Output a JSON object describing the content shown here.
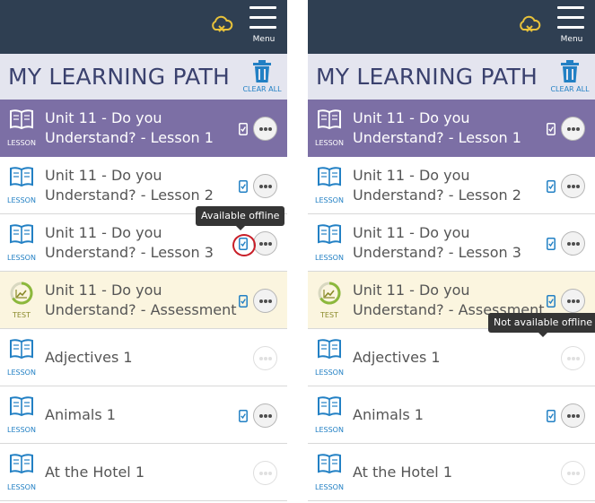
{
  "colors": {
    "topbar": "#2f3f52",
    "titlebar": "#e4e5ef",
    "title_text": "#3a416e",
    "accent_blue": "#2280c4",
    "active_row": "#7c6fa5",
    "test_row": "#fbf5df",
    "cloud_icon": "#e8c23a",
    "highlight_ring": "#c81e28",
    "tooltip_bg": "#353535"
  },
  "panels": [
    {
      "header": {
        "cloud_icon": "cloud-offline-icon",
        "menu_label": "Menu"
      },
      "title": "MY LEARNING PATH",
      "clear_all": "CLEAR ALL",
      "tooltip": "Available offline",
      "items": [
        {
          "title_line1": "Unit 11 - Do you",
          "title_line2": "Understand? - Lesson 1",
          "type": "LESSON",
          "icon": "book-icon",
          "offline_available": true,
          "state": "active"
        },
        {
          "title_line1": "Unit 11 - Do you",
          "title_line2": "Understand? - Lesson 2",
          "type": "LESSON",
          "icon": "book-icon",
          "offline_available": true,
          "state": "normal"
        },
        {
          "title_line1": "Unit 11 - Do you",
          "title_line2": "Understand? - Lesson 3",
          "type": "LESSON",
          "icon": "book-icon",
          "offline_available": true,
          "state": "normal"
        },
        {
          "title_line1": "Unit 11 - Do you",
          "title_line2": "Understand? - Assessment",
          "type": "TEST",
          "icon": "test-chart-icon",
          "offline_available": true,
          "state": "test"
        },
        {
          "title": "Adjectives 1",
          "type": "LESSON",
          "icon": "book-icon",
          "offline_available": false,
          "state": "normal"
        },
        {
          "title": "Animals 1",
          "type": "LESSON",
          "icon": "book-icon",
          "offline_available": true,
          "state": "normal"
        },
        {
          "title": "At the Hotel 1",
          "type": "LESSON",
          "icon": "book-icon",
          "offline_available": false,
          "state": "normal"
        }
      ]
    },
    {
      "header": {
        "cloud_icon": "cloud-offline-icon",
        "menu_label": "Menu"
      },
      "title": "MY LEARNING PATH",
      "clear_all": "CLEAR ALL",
      "tooltip": "Not available offline",
      "items": [
        {
          "title_line1": "Unit 11 - Do you",
          "title_line2": "Understand? - Lesson 1",
          "type": "LESSON",
          "icon": "book-icon",
          "offline_available": true,
          "state": "active"
        },
        {
          "title_line1": "Unit 11 - Do you",
          "title_line2": "Understand? - Lesson 2",
          "type": "LESSON",
          "icon": "book-icon",
          "offline_available": true,
          "state": "normal"
        },
        {
          "title_line1": "Unit 11 - Do you",
          "title_line2": "Understand? - Lesson 3",
          "type": "LESSON",
          "icon": "book-icon",
          "offline_available": true,
          "state": "normal"
        },
        {
          "title_line1": "Unit 11 - Do you",
          "title_line2": "Understand? - Assessment",
          "type": "TEST",
          "icon": "test-chart-icon",
          "offline_available": true,
          "state": "test"
        },
        {
          "title": "Adjectives 1",
          "type": "LESSON",
          "icon": "book-icon",
          "offline_available": false,
          "state": "normal"
        },
        {
          "title": "Animals 1",
          "type": "LESSON",
          "icon": "book-icon",
          "offline_available": true,
          "state": "normal"
        },
        {
          "title": "At the Hotel 1",
          "type": "LESSON",
          "icon": "book-icon",
          "offline_available": false,
          "state": "normal"
        }
      ]
    }
  ]
}
